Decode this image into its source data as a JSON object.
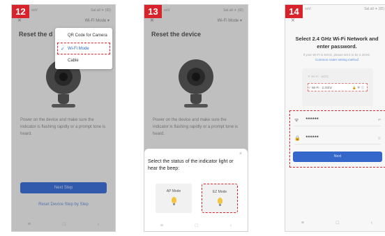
{
  "steps": [
    {
      "number": "12",
      "statusbar": {
        "left": "ooV",
        "right": "Sal.all ✈ (ID)"
      },
      "close": "×",
      "wifi_mode_label": "Wi-Fi Mode ▾",
      "title": "Reset the d",
      "dropdown": [
        {
          "label": "QR Code for Camera",
          "selected": false
        },
        {
          "label": "Wi-Fi Mode",
          "selected": true
        },
        {
          "label": "Cable",
          "selected": false
        }
      ],
      "instruction": "Power on the device and make sure the indicator is flashing rapidly or a prompt tone is heard.",
      "next_button": "Next Step",
      "link": "Reset Device Step by Step",
      "nav": [
        "≡",
        "□",
        "‹"
      ]
    },
    {
      "number": "13",
      "statusbar": {
        "left": "ooV",
        "right": "Sal.all ✈ (ID)"
      },
      "close": "×",
      "wifi_mode_label": "Wi-Fi Mode ▾",
      "title": "Reset the device",
      "instruction": "Power on the device and make sure the indicator is flashing rapidly or a prompt tone is heard.",
      "sheet": {
        "close": "×",
        "title": "Select the status of the indicator light or hear the beep:",
        "modes": [
          {
            "label": "AP Mode",
            "selected": false
          },
          {
            "label": "EZ Mode",
            "selected": true
          }
        ]
      },
      "nav": [
        "≡",
        "□",
        "‹"
      ]
    },
    {
      "number": "14",
      "statusbar": {
        "left": "ooV",
        "right": "Sal.all ✈ (ID)"
      },
      "close": "×",
      "title": "Select 2.4 GHz Wi-Fi Network and enter password.",
      "note": "If your Wi-Fi is 5GHz, please set it to be 2.4GHz.",
      "note_link": "Common router setting method",
      "illustration": [
        {
          "left": "✕ Wi-Fi · 5Ghz",
          "right": "",
          "highlight": false
        },
        {
          "left": "✓ Wi-Fi · 2.4Ghz",
          "right": "🔒 ᯤ ⓘ",
          "highlight": true
        },
        {
          "left": "",
          "right": "",
          "highlight": false
        }
      ],
      "wifi_field": {
        "icon": "ᯤ",
        "value": "******",
        "suffix": "⇄"
      },
      "password_field": {
        "icon": "🔒",
        "value": "******",
        "suffix": "◎"
      },
      "next_button": "Next",
      "nav": [
        "≡",
        "□",
        "‹"
      ]
    }
  ],
  "colors": {
    "badge": "#d8232a",
    "primary": "#3c6ed3",
    "highlight_dash": "#d8232a"
  }
}
